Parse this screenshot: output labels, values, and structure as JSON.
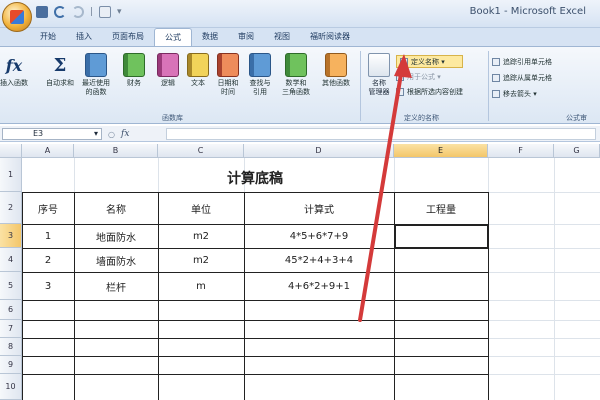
{
  "window": {
    "title": "Book1 - Microsoft Excel"
  },
  "tabs": [
    {
      "label": "开始",
      "active": false
    },
    {
      "label": "插入",
      "active": false
    },
    {
      "label": "页面布局",
      "active": false
    },
    {
      "label": "公式",
      "active": true
    },
    {
      "label": "数据",
      "active": false
    },
    {
      "label": "审阅",
      "active": false
    },
    {
      "label": "视图",
      "active": false
    },
    {
      "label": "福昕阅读器",
      "active": false
    }
  ],
  "ribbon": {
    "insert_function": "插入函数",
    "autosum": "自动求和",
    "recent": [
      "最近使用",
      "的函数"
    ],
    "financial": "财务",
    "logical": "逻辑",
    "text": "文本",
    "datetime": [
      "日期和",
      "时间"
    ],
    "lookup": [
      "查找与",
      "引用"
    ],
    "math": [
      "数学和",
      "三角函数"
    ],
    "more": "其他函数",
    "library_label": "函数库",
    "name_manager": [
      "名称",
      "管理器"
    ],
    "define_name": "定义名称",
    "use_in_formula": "用于公式",
    "create_from_selection": "根据所选内容创建",
    "names_group_label": "定义的名称",
    "trace_precedents": "追踪引用单元格",
    "trace_dependents": "追踪从属单元格",
    "remove_arrows": "移去箭头",
    "audit_label": "公式审"
  },
  "formula_bar": {
    "name_box": "E3",
    "fx": "fx",
    "value": ""
  },
  "columns": [
    "A",
    "B",
    "C",
    "D",
    "E",
    "F",
    "G"
  ],
  "rows": [
    "1",
    "2",
    "3",
    "4",
    "5",
    "6",
    "7",
    "8",
    "9",
    "10"
  ],
  "sheet": {
    "title": "计算底稿",
    "headers": [
      "序号",
      "名称",
      "单位",
      "计算式",
      "工程量"
    ],
    "data": [
      [
        "1",
        "地面防水",
        "m2",
        "4*5+6*7+9",
        ""
      ],
      [
        "2",
        "墙面防水",
        "m2",
        "45*2+4+3+4",
        ""
      ],
      [
        "3",
        "栏杆",
        "m",
        "4+6*2+9+1",
        ""
      ]
    ]
  },
  "colors": {
    "arrow": "#d43a3a",
    "selected_header": "#f3c66a",
    "ribbon_bg": "#dce7f4"
  }
}
